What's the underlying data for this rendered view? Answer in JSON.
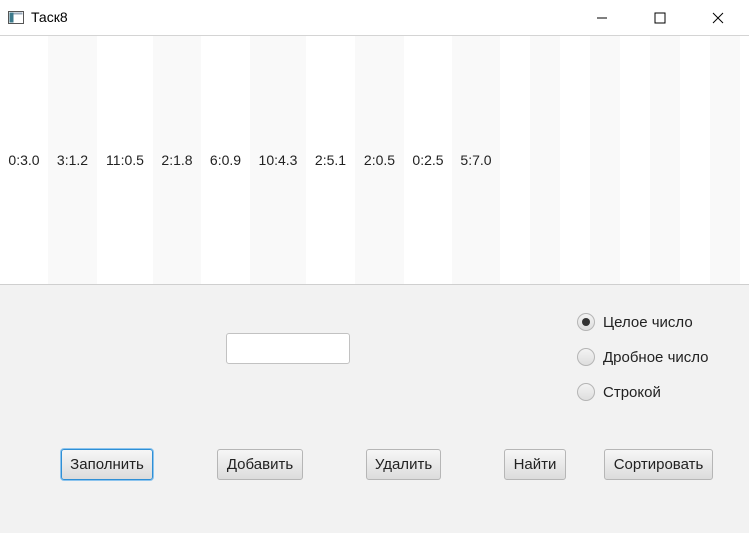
{
  "window": {
    "title": "Таск8",
    "icon": "java-app-icon",
    "controls": [
      "minimize-icon",
      "maximize-icon",
      "close-icon"
    ]
  },
  "list": {
    "items": [
      "0:3.0",
      "3:1.2",
      "11:0.5",
      "2:1.8",
      "6:0.9",
      "10:4.3",
      "2:5.1",
      "2:0.5",
      "0:2.5",
      "5:7.0"
    ],
    "empty_cells": 8,
    "stripe_color": "#f9f9f9"
  },
  "input": {
    "value": "",
    "placeholder": ""
  },
  "radio_group": {
    "options": [
      {
        "label": "Целое число",
        "selected": true
      },
      {
        "label": "Дробное число",
        "selected": false
      },
      {
        "label": "Строкой",
        "selected": false
      }
    ]
  },
  "buttons": {
    "fill": "Заполнить",
    "add": "Добавить",
    "delete": "Удалить",
    "find": "Найти",
    "sort": "Сортировать",
    "focused": "fill",
    "focus_color": "#2f8fd5"
  }
}
